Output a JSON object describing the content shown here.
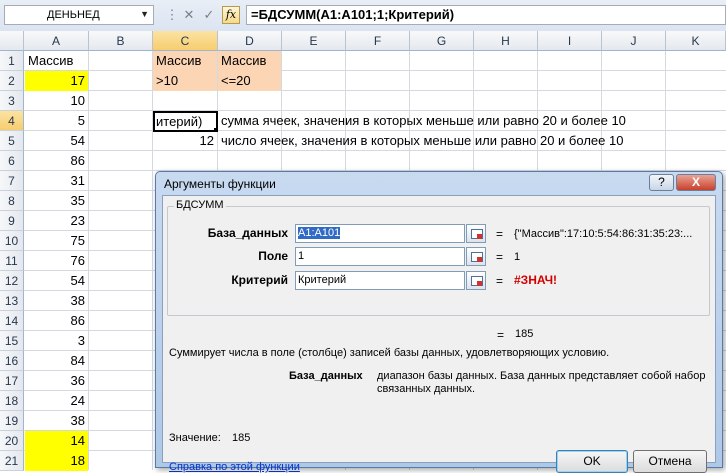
{
  "formula_bar": {
    "name_box": "ДЕНЬНЕД",
    "name_arrow": "▼",
    "cancel_icon": "✕",
    "enter_icon": "✓",
    "fx_label": "fx",
    "formula": "=БДСУММ(A1:A101;1;Критерий)"
  },
  "columns": [
    "A",
    "B",
    "C",
    "D",
    "E",
    "F",
    "G",
    "H",
    "I",
    "J",
    "K"
  ],
  "rows": [
    "1",
    "2",
    "3",
    "4",
    "5",
    "6",
    "7",
    "8",
    "9",
    "10",
    "11",
    "12",
    "13",
    "14",
    "15",
    "16",
    "17",
    "18",
    "19",
    "20",
    "21"
  ],
  "sheet": {
    "a1": "Массив",
    "col_a": [
      "17",
      "10",
      "5",
      "54",
      "86",
      "31",
      "35",
      "23",
      "75",
      "76",
      "54",
      "38",
      "86",
      "3",
      "84",
      "36",
      "24",
      "38",
      "14",
      "18"
    ],
    "c1": "Массив",
    "d1": "Массив",
    "c2": ">10",
    "d2": "<=20",
    "c4": "итерий)",
    "d4": "сумма ячеек, значения в которых меньше или равно 20 и более 10",
    "c5": "12",
    "d5": "число ячеек, значения в которых меньше или равно 20 и более 10",
    "highlight_color": "#ffff00",
    "criteria_color": "#fcd5b4"
  },
  "dialog": {
    "title": "Аргументы функции",
    "help_btn": "?",
    "close_btn": "X",
    "function_name": "БДСУММ",
    "args": [
      {
        "label": "База_данных",
        "value": "A1:A101",
        "eq": "=",
        "result": "{\"Массив\":17:10:5:54:86:31:35:23:..."
      },
      {
        "label": "Поле",
        "value": "1",
        "eq": "=",
        "result": "1"
      },
      {
        "label": "Критерий",
        "value": "Критерий",
        "eq": "=",
        "result": "#ЗНАЧ!"
      }
    ],
    "result_eq": "=",
    "result_value": "185",
    "description": "Суммирует числа в поле (столбце) записей базы данных, удовлетворяющих условию.",
    "arg_name": "База_данных",
    "arg_description": "диапазон базы данных. База данных представляет собой набор связанных данных.",
    "value_label": "Значение:",
    "value": "185",
    "help_link": "Справка по этой функции",
    "ok": "OK",
    "cancel": "Отмена"
  }
}
